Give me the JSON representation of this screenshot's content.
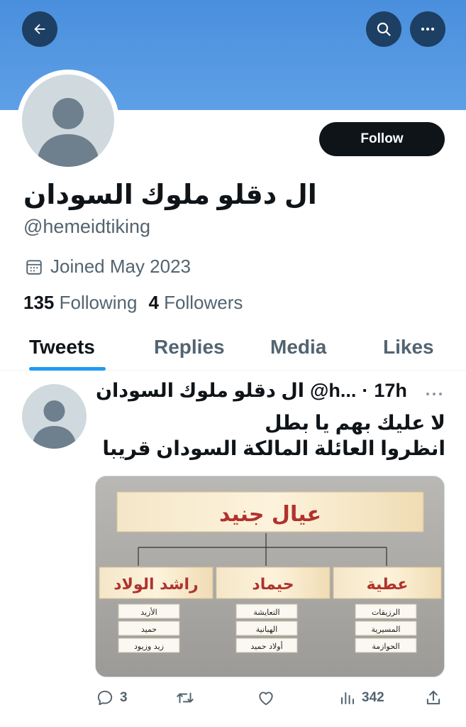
{
  "header": {
    "back_icon": "arrow-left-icon",
    "search_icon": "search-icon",
    "more_icon": "more-horizontal-icon",
    "banner_color": "#4a90d9"
  },
  "profile": {
    "display_name": "ال دقلو ملوك السودان",
    "handle": "@hemeidtiking",
    "follow_label": "Follow",
    "joined": "Joined May 2023",
    "following_count": "135",
    "following_label": "Following",
    "followers_count": "4",
    "followers_label": "Followers"
  },
  "tabs": [
    {
      "label": "Tweets",
      "active": true
    },
    {
      "label": "Replies",
      "active": false
    },
    {
      "label": "Media",
      "active": false
    },
    {
      "label": "Likes",
      "active": false
    }
  ],
  "tweet": {
    "name": "ال دقلو ملوك السودان",
    "handle": "@h...",
    "separator": "·",
    "time": "17h",
    "text_line1": "لا عليك بهم يا بطل",
    "text_line2": "انظروا العائلة المالكة السودان قريبا",
    "image": {
      "title": "عيال جنيد",
      "branches": [
        {
          "name": "راشد الولاد",
          "children": [
            "الأزيد",
            "حميد",
            "زيد وزيود"
          ]
        },
        {
          "name": "حيماد",
          "children": [
            "التعايشة",
            "الهبانية",
            "أولاد حميد"
          ]
        },
        {
          "name": "عطية",
          "children": [
            "الرزيقات",
            "المسيرية",
            "الحوازمة"
          ]
        }
      ]
    },
    "actions": {
      "reply_count": "3",
      "retweet_count": "",
      "like_count": "",
      "views_count": "342"
    }
  },
  "colors": {
    "accent": "#1d9bf0",
    "text_primary": "#0f1419",
    "text_secondary": "#536471"
  }
}
